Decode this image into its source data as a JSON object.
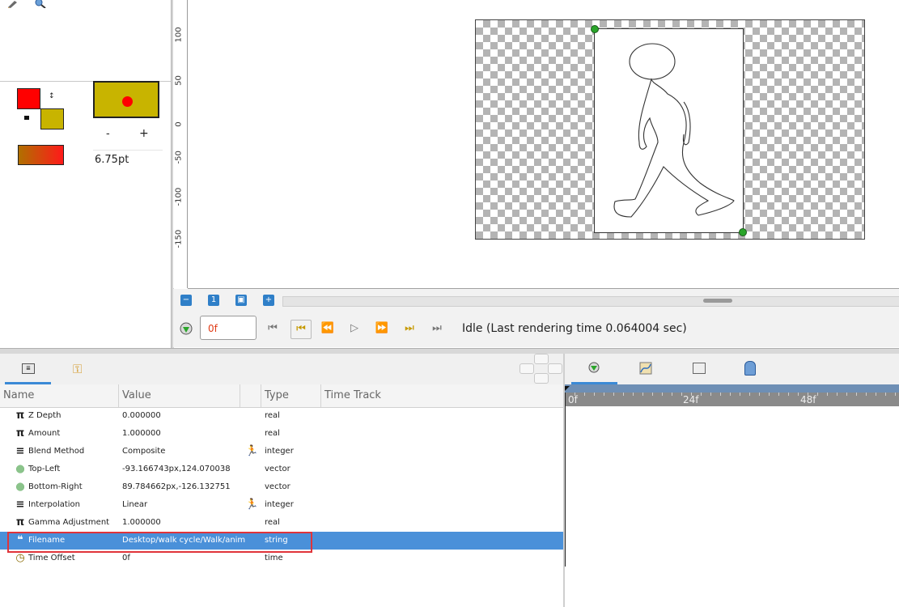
{
  "toolbox": {
    "brush_size": "6.75pt",
    "minus_label": "-",
    "plus_label": "+",
    "colors": {
      "outline": "#ff0000",
      "fill": "#c8b400",
      "preview_dot": "#ff0000"
    }
  },
  "ruler": {
    "labels": [
      "100",
      "50",
      "0",
      "-50",
      "-100",
      "-150"
    ]
  },
  "transport": {
    "time_value": "0f",
    "status": "Idle (Last rendering time 0.064004 sec)"
  },
  "params": {
    "columns": [
      "Name",
      "Value",
      "Type",
      "Time Track"
    ],
    "rows": [
      {
        "icon": "pi-icon",
        "glyph": "π",
        "name": "Z Depth",
        "value": "0.000000",
        "type": "real",
        "anim": false,
        "selected": false
      },
      {
        "icon": "pi-icon",
        "glyph": "π",
        "name": "Amount",
        "value": "1.000000",
        "type": "real",
        "anim": false,
        "selected": false
      },
      {
        "icon": "enum-icon",
        "glyph": "≡",
        "name": "Blend Method",
        "value": "Composite",
        "type": "integer",
        "anim": true,
        "selected": false
      },
      {
        "icon": "vector-icon",
        "glyph": "●",
        "name": "Top-Left",
        "value": "-93.166743px,124.070038",
        "type": "vector",
        "anim": false,
        "selected": false
      },
      {
        "icon": "vector-icon",
        "glyph": "●",
        "name": "Bottom-Right",
        "value": "89.784662px,-126.132751",
        "type": "vector",
        "anim": false,
        "selected": false
      },
      {
        "icon": "enum-icon",
        "glyph": "≡",
        "name": "Interpolation",
        "value": "Linear",
        "type": "integer",
        "anim": true,
        "selected": false
      },
      {
        "icon": "pi-icon",
        "glyph": "π",
        "name": "Gamma Adjustment",
        "value": "1.000000",
        "type": "real",
        "anim": false,
        "selected": false
      },
      {
        "icon": "quote-icon",
        "glyph": "❝",
        "name": "Filename",
        "value": "Desktop/walk cycle/Walk/anim",
        "type": "string",
        "anim": false,
        "selected": true
      },
      {
        "icon": "clock-icon",
        "glyph": "◷",
        "name": "Time Offset",
        "value": "0f",
        "type": "time",
        "anim": false,
        "selected": false
      }
    ]
  },
  "timeline": {
    "ticks": [
      "0f",
      "24f",
      "48f"
    ]
  }
}
